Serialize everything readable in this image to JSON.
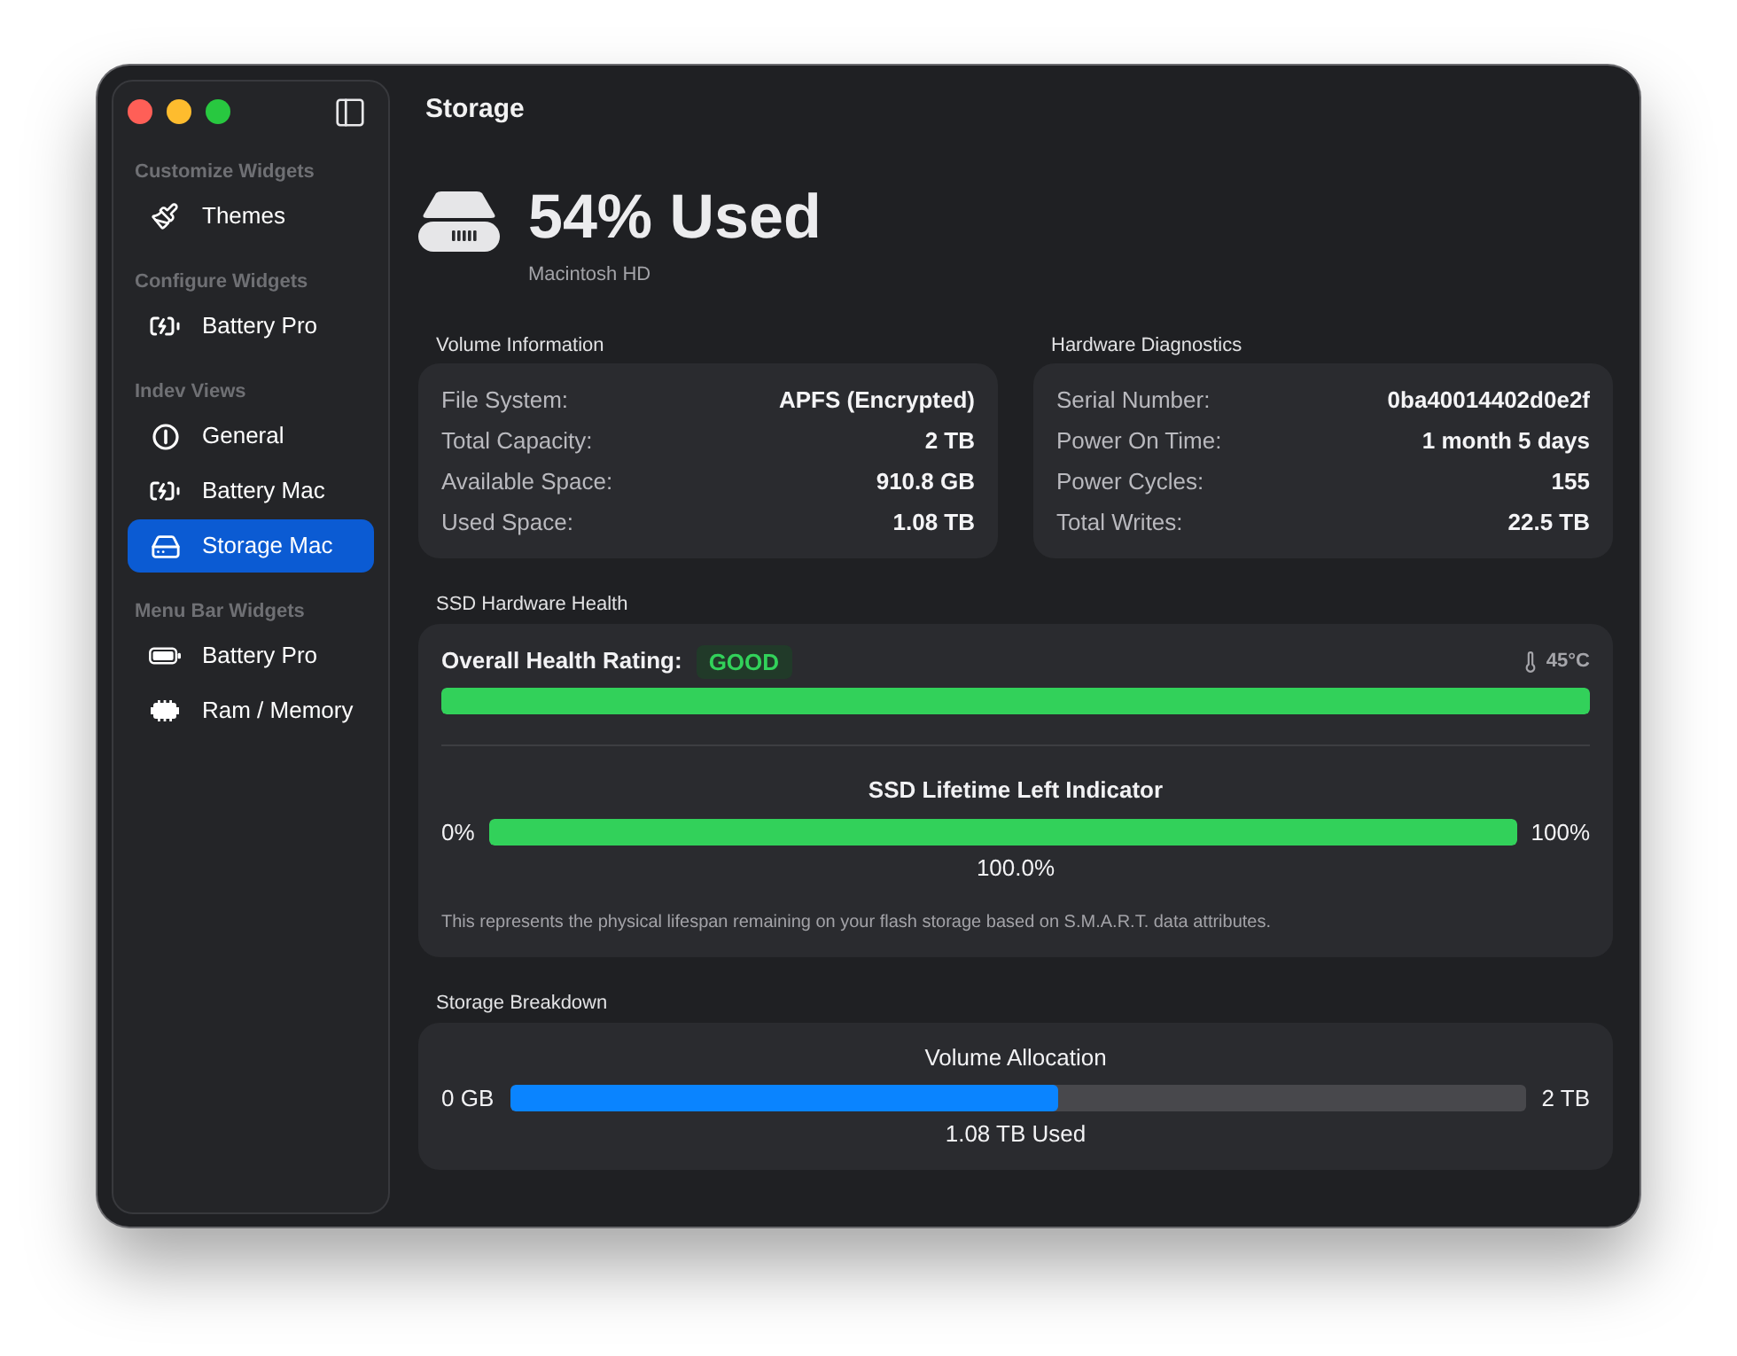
{
  "sidebar": {
    "sections": [
      {
        "title": "Customize Widgets",
        "items": [
          {
            "label": "Themes",
            "selected": false
          }
        ]
      },
      {
        "title": "Configure Widgets",
        "items": [
          {
            "label": "Battery Pro",
            "selected": false
          }
        ]
      },
      {
        "title": "Indev Views",
        "items": [
          {
            "label": "General",
            "selected": false
          },
          {
            "label": "Battery Mac",
            "selected": false
          },
          {
            "label": "Storage Mac",
            "selected": true
          }
        ]
      },
      {
        "title": "Menu Bar Widgets",
        "items": [
          {
            "label": "Battery Pro",
            "selected": false
          },
          {
            "label": "Ram / Memory",
            "selected": false
          }
        ]
      }
    ]
  },
  "page_title": "Storage",
  "summary": {
    "headline": "54% Used",
    "volume_name": "Macintosh HD"
  },
  "panels": [
    {
      "title": "Volume Information",
      "rows": [
        {
          "label": "File System:",
          "value": "APFS (Encrypted)"
        },
        {
          "label": "Total Capacity:",
          "value": "2 TB"
        },
        {
          "label": "Available Space:",
          "value": "910.8 GB"
        },
        {
          "label": "Used Space:",
          "value": "1.08 TB"
        }
      ]
    },
    {
      "title": "Hardware Diagnostics",
      "rows": [
        {
          "label": "Serial Number:",
          "value": "0ba40014402d0e2f"
        },
        {
          "label": "Power On Time:",
          "value": "1 month 5 days"
        },
        {
          "label": "Power Cycles:",
          "value": "155"
        },
        {
          "label": "Total Writes:",
          "value": "22.5 TB"
        }
      ]
    }
  ],
  "ssd_health": {
    "title": "SSD Hardware Health",
    "rating_label": "Overall Health Rating:",
    "rating": "GOOD",
    "temperature": "45°C",
    "health_bar": {
      "level": 1
    },
    "lifetime": {
      "title": "SSD Lifetime Left Indicator",
      "min_label": "0%",
      "max_label": "100%",
      "level": 1,
      "reading": "100.0%"
    },
    "note": "This represents the physical lifespan remaining on your flash storage based on S.M.A.R.T. data attributes."
  },
  "storage_breakdown": {
    "title": "Storage Breakdown",
    "allocation": {
      "title": "Volume Allocation",
      "min_label": "0 GB",
      "max_label": "2 TB",
      "level": 0.54,
      "reading": "1.08 TB Used"
    }
  }
}
